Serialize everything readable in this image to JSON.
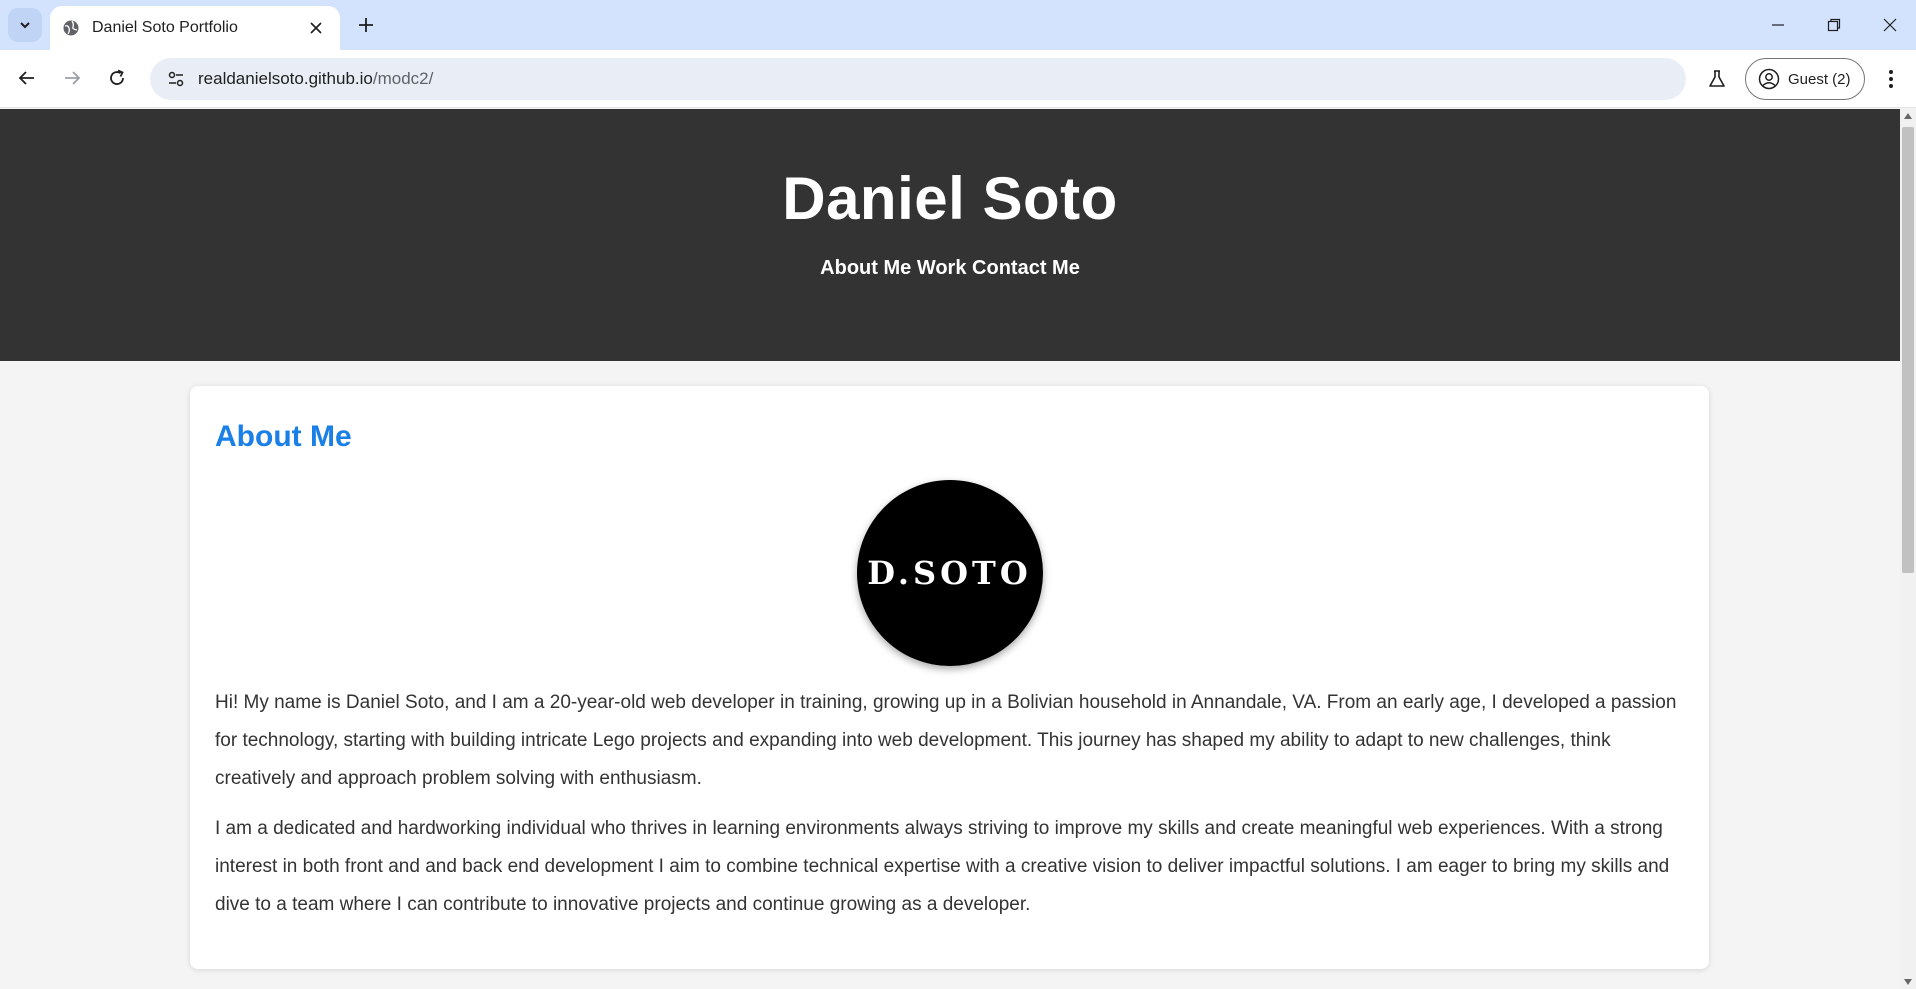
{
  "browser": {
    "tab_title": "Daniel Soto Portfolio",
    "url_host": "realdanielsoto.github.io",
    "url_path": "/modc2/",
    "profile_label": "Guest (2)"
  },
  "page": {
    "site_title": "Daniel Soto",
    "nav": [
      "About Me",
      "Work",
      "Contact Me"
    ],
    "about": {
      "heading": "About Me",
      "logo_text": "D.SOTO",
      "paragraphs": [
        "Hi! My name is Daniel Soto, and I am a 20-year-old web developer in training, growing up in a Bolivian household in Annandale, VA. From an early age, I developed a passion for technology, starting with building intricate Lego projects and expanding into web development. This journey has shaped my ability to adapt to new challenges, think creatively and approach problem solving with enthusiasm.",
        "I am a dedicated and hardworking individual who thrives in learning environments always striving to improve my skills and create meaningful web experiences. With a strong interest in both front and and back end development I aim to combine technical expertise with a creative vision to deliver impactful solutions. I am eager to bring my skills and dive to a team where I can contribute to innovative projects and continue growing as a developer."
      ]
    }
  },
  "colors": {
    "header_bg": "#333333",
    "accent": "#1a7fe6",
    "page_bg": "#f4f4f4",
    "tabstrip_bg": "#d3e3fd"
  }
}
